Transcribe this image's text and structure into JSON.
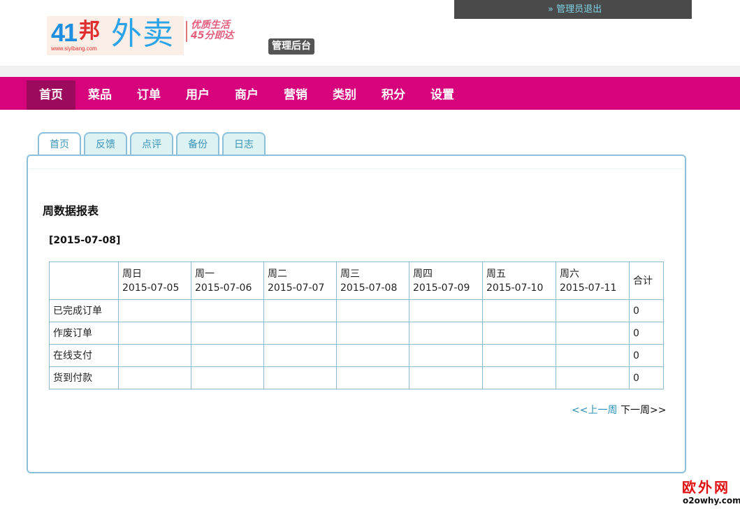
{
  "header": {
    "logo": {
      "brand_number": "41",
      "brand_char": "邦",
      "url": "www.siyibang.com",
      "name": "外卖"
    },
    "slogan": {
      "line1": "优质生活",
      "line2": "45分即达"
    },
    "admin_badge": "管理后台",
    "logout": "» 管理员退出"
  },
  "nav": {
    "items": [
      "首页",
      "菜品",
      "订单",
      "用户",
      "商户",
      "营销",
      "类别",
      "积分",
      "设置"
    ],
    "active_index": 0,
    "colors": {
      "bar": "#d6037c",
      "active": "#9b0a5d"
    }
  },
  "tabs": {
    "items": [
      "首页",
      "反馈",
      "点评",
      "备份",
      "日志"
    ],
    "active_index": 0
  },
  "report": {
    "title": "周数据报表",
    "date": "[2015-07-08]",
    "columns": [
      {
        "day": "周日",
        "date": "2015-07-05"
      },
      {
        "day": "周一",
        "date": "2015-07-06"
      },
      {
        "day": "周二",
        "date": "2015-07-07"
      },
      {
        "day": "周三",
        "date": "2015-07-08"
      },
      {
        "day": "周四",
        "date": "2015-07-09"
      },
      {
        "day": "周五",
        "date": "2015-07-10"
      },
      {
        "day": "周六",
        "date": "2015-07-11"
      }
    ],
    "total_label": "合计",
    "rows": [
      {
        "label": "已完成订单",
        "values": [
          "",
          "",
          "",
          "",
          "",
          "",
          ""
        ],
        "total": "0"
      },
      {
        "label": "作废订单",
        "values": [
          "",
          "",
          "",
          "",
          "",
          "",
          ""
        ],
        "total": "0"
      },
      {
        "label": "在线支付",
        "values": [
          "",
          "",
          "",
          "",
          "",
          "",
          ""
        ],
        "total": "0"
      },
      {
        "label": "货到付款",
        "values": [
          "",
          "",
          "",
          "",
          "",
          "",
          ""
        ],
        "total": "0"
      }
    ]
  },
  "pager": {
    "prev": "<<上一周",
    "next": "下一周>>"
  },
  "watermark": {
    "line1": "欧外网",
    "line2": "o2owhy.com"
  }
}
